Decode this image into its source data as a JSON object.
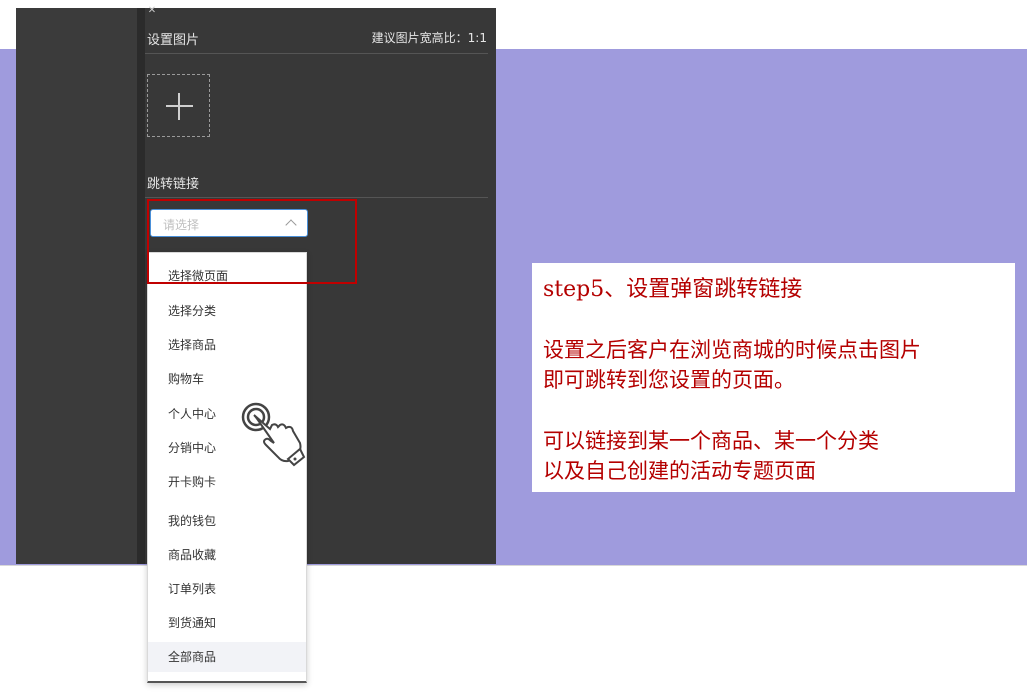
{
  "panel": {
    "close_icon": "close-icon",
    "image_section_title": "设置图片",
    "ratio_hint": "建议图片宽高比：1:1",
    "upload_icon": "plus-icon",
    "link_section_title": "跳转链接",
    "select_placeholder": "请选择",
    "select_icon": "chevron-up-icon",
    "options": [
      "选择微页面",
      "选择分类",
      "选择商品",
      "购物车",
      "个人中心",
      "分销中心",
      "开卡购卡",
      "我的钱包",
      "商品收藏",
      "订单列表",
      "到货通知",
      "全部商品"
    ],
    "hovered_option": "全部商品",
    "cursor_icon": "hand-pointer-icon"
  },
  "annotation": {
    "step_title": "step5、设置弹窗跳转链接",
    "para1_line1": "设置之后客户在浏览商城的时候点击图片",
    "para1_line2": "即可跳转到您设置的页面。",
    "para2_line1": "可以链接到某一个商品、某一个分类",
    "para2_line2": "以及自己创建的活动专题页面"
  },
  "colors": {
    "band": "#9f9bdd",
    "panel": "#383838",
    "highlight_border": "#c00000",
    "annotation_text": "#b40000",
    "select_border": "#4a90d9"
  }
}
